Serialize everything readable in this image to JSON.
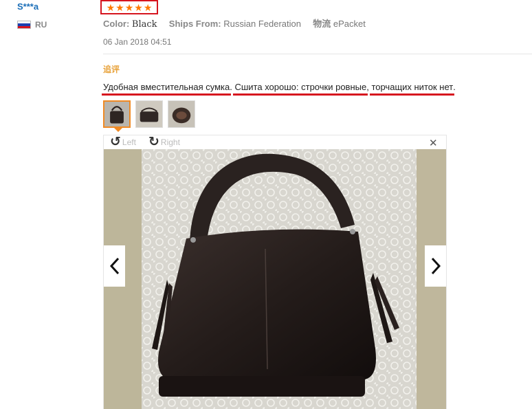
{
  "user": {
    "name": "S***a",
    "country": "RU",
    "flag": [
      "#ffffff",
      "#1b3fb0",
      "#d6141e"
    ]
  },
  "rating": {
    "stars": 5,
    "star_glyph": "★",
    "max": 5,
    "highlight_color": "#d6141e",
    "star_color": "#ff7a00"
  },
  "meta": {
    "color_label": "Color:",
    "color_value": "Black",
    "ships_label": "Ships From:",
    "ships_value": "Russian Federation",
    "logistics_label": "物流",
    "logistics_value": "ePacket"
  },
  "date": "06 Jan 2018 04:51",
  "additional_label": "追评",
  "review": {
    "segments": [
      {
        "text": "Удобная вместительная сумка",
        "underlined": true
      },
      {
        "text": ". ",
        "underlined": false
      },
      {
        "text": "Сшита хорошо: строчки ровные",
        "underlined": true
      },
      {
        "text": ", ",
        "underlined": false
      },
      {
        "text": "торчащих ниток нет",
        "underlined": true
      },
      {
        "text": ".",
        "underlined": false
      }
    ]
  },
  "thumbnails": [
    {
      "alt": "bag photo 1",
      "active": true
    },
    {
      "alt": "bag photo 2",
      "active": false
    },
    {
      "alt": "bag photo 3",
      "active": false
    }
  ],
  "viewer": {
    "rotate_left": "Left",
    "rotate_right": "Right",
    "rotate_left_icon": "rotate-left-icon",
    "rotate_right_icon": "rotate-right-icon",
    "close_icon": "close-icon",
    "close_glyph": "✕",
    "prev_icon": "chevron-left-icon",
    "next_icon": "chevron-right-icon"
  },
  "colors": {
    "username": "#1c6fb8",
    "additional": "#e8a23a",
    "active_thumb": "#f08a24"
  }
}
